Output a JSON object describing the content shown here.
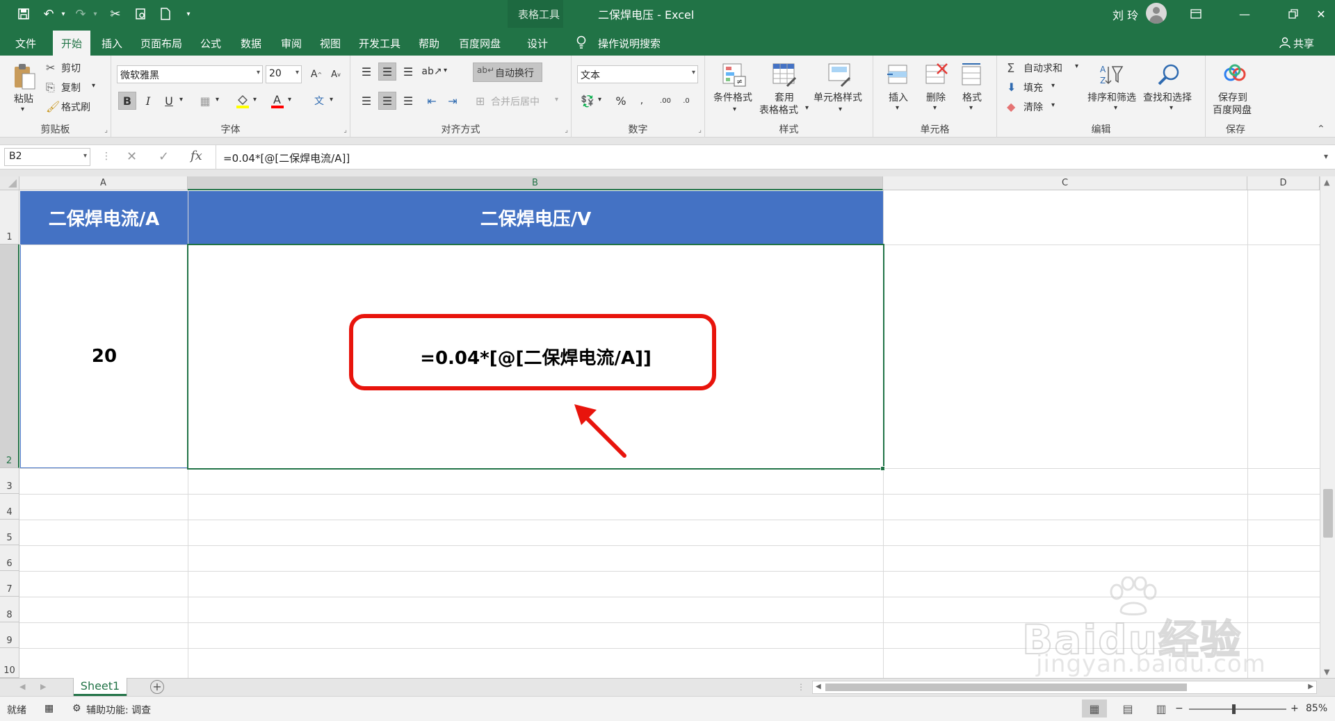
{
  "titlebar": {
    "context_tab_label": "表格工具",
    "window_title": "二保焊电压  -  Excel",
    "user_name": "刘 玲",
    "colors": {
      "accent": "#217346"
    }
  },
  "quick_access": [
    "save-icon",
    "undo-icon",
    "redo-icon",
    "cut-icon",
    "print-preview-icon",
    "new-icon",
    "customize-icon"
  ],
  "tabs": {
    "file": "文件",
    "home": "开始",
    "insert": "插入",
    "page_layout": "页面布局",
    "formulas": "公式",
    "data": "数据",
    "review": "审阅",
    "view": "视图",
    "developer": "开发工具",
    "help": "帮助",
    "baidu": "百度网盘",
    "design": "设计",
    "tell_me": "操作说明搜索",
    "share": "共享"
  },
  "ribbon": {
    "clipboard": {
      "label": "剪贴板",
      "paste": "粘贴",
      "cut": "剪切",
      "copy": "复制",
      "format_painter": "格式刷"
    },
    "font": {
      "label": "字体",
      "family": "微软雅黑",
      "size": "20",
      "bold": "B",
      "italic": "I",
      "underline": "U"
    },
    "alignment": {
      "label": "对齐方式",
      "wrap_text": "自动换行",
      "merge_center": "合并后居中"
    },
    "number": {
      "label": "数字",
      "format": "文本"
    },
    "styles": {
      "label": "样式",
      "conditional": "条件格式",
      "table_format_1": "套用",
      "table_format_2": "表格格式",
      "cell_styles": "单元格样式"
    },
    "cells": {
      "label": "单元格",
      "insert": "插入",
      "delete": "删除",
      "format": "格式"
    },
    "editing": {
      "label": "编辑",
      "autosum": "自动求和",
      "fill": "填充",
      "clear": "清除",
      "sort_filter": "排序和筛选",
      "find_select": "查找和选择"
    },
    "save": {
      "label": "保存",
      "save_to_1": "保存到",
      "save_to_2": "百度网盘"
    }
  },
  "formula_bar": {
    "name_box": "B2",
    "fx": "fx",
    "formula": "=0.04*[@[二保焊电流/A]]"
  },
  "grid": {
    "columns": [
      "A",
      "B",
      "C",
      "D"
    ],
    "rows": [
      "1",
      "2",
      "3",
      "4",
      "5",
      "6",
      "7",
      "8",
      "9",
      "10"
    ],
    "header_row": [
      "二保焊电流/A",
      "二保焊电压/V"
    ],
    "a2_value": "20",
    "b2_display": "=0.04*[@[二保焊电流/A]]",
    "colors": {
      "table_header": "#4472c4",
      "callout": "#e8140c"
    }
  },
  "sheet_tabs": {
    "active": "Sheet1"
  },
  "status_bar": {
    "ready": "就绪",
    "accessibility": "辅助功能: 调查",
    "zoom": "85%",
    "minus": "−",
    "plus": "+"
  },
  "watermark": {
    "brand": "Baidu经验",
    "url": "jingyan.baidu.com"
  }
}
